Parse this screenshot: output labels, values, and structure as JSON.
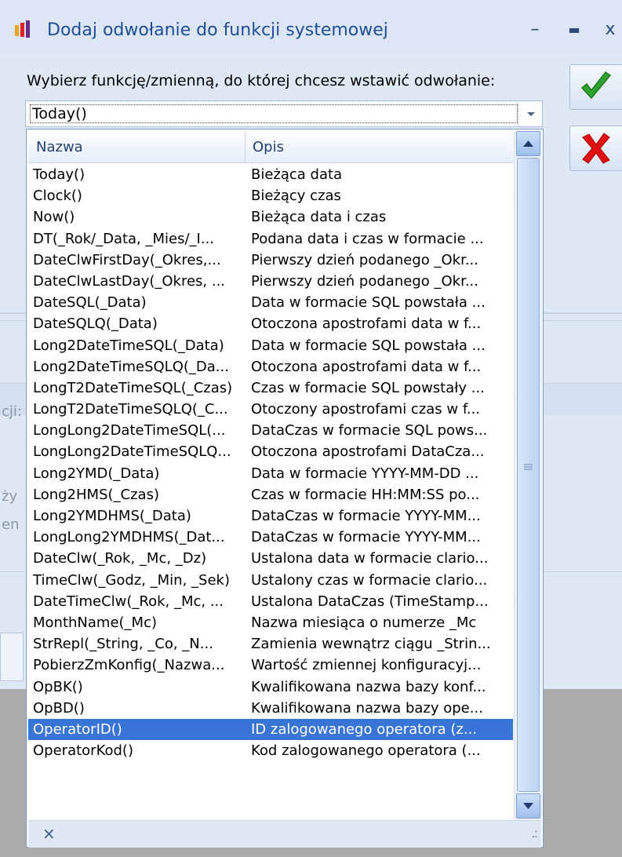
{
  "window": {
    "title": "Dodaj odwołanie do funkcji systemowej",
    "minimize_glyph": "–",
    "maximize_glyph": "▬",
    "close_glyph": "x"
  },
  "prompt": "Wybierz funkcję/zmienną, do której chcesz wstawić odwołanie:",
  "combo": {
    "value": "Today()"
  },
  "background_fragments": {
    "a": "cji:",
    "b": "ży",
    "c": "en"
  },
  "list": {
    "columns": [
      "Nazwa",
      "Opis"
    ],
    "rows": [
      {
        "name": "Today()",
        "desc": "Bieżąca data"
      },
      {
        "name": "Clock()",
        "desc": "Bieżący czas"
      },
      {
        "name": "Now()",
        "desc": "Bieżąca data i czas"
      },
      {
        "name": "DT(_Rok/_Data, _Mies/_I...",
        "desc": "Podana data i czas w formacie ..."
      },
      {
        "name": "DateClwFirstDay(_Okres,...",
        "desc": "Pierwszy dzień podanego _Okr..."
      },
      {
        "name": "DateClwLastDay(_Okres, ...",
        "desc": "Pierwszy dzień podanego _Okr..."
      },
      {
        "name": "DateSQL(_Data)",
        "desc": "Data w formacie SQL powstała ..."
      },
      {
        "name": "DateSQLQ(_Data)",
        "desc": "Otoczona apostrofami data w f..."
      },
      {
        "name": "Long2DateTimeSQL(_Data)",
        "desc": "Data w formacie SQL powstała ..."
      },
      {
        "name": "Long2DateTimeSQLQ(_Da...",
        "desc": "Otoczona apostrofami data w f..."
      },
      {
        "name": "LongT2DateTimeSQL(_Czas)",
        "desc": "Czas w formacie SQL powstały ..."
      },
      {
        "name": "LongT2DateTimeSQLQ(_C...",
        "desc": "Otoczony apostrofami czas w f..."
      },
      {
        "name": "LongLong2DateTimeSQL(...",
        "desc": "DataCzas w formacie SQL pows..."
      },
      {
        "name": "LongLong2DateTimeSQLQ...",
        "desc": "Otoczona apostrofami DataCza..."
      },
      {
        "name": "Long2YMD(_Data)",
        "desc": "Data w formacie YYYY-MM-DD ..."
      },
      {
        "name": "Long2HMS(_Czas)",
        "desc": "Czas w formacie HH:MM:SS po..."
      },
      {
        "name": "Long2YMDHMS(_Data)",
        "desc": "DataCzas w formacie YYYY-MM..."
      },
      {
        "name": "LongLong2YMDHMS(_Dat...",
        "desc": "DataCzas w formacie YYYY-MM..."
      },
      {
        "name": "DateClw(_Rok, _Mc, _Dz)",
        "desc": "Ustalona data w formacie clario..."
      },
      {
        "name": "TimeClw(_Godz, _Min, _Sek)",
        "desc": "Ustalony czas w formacie clario..."
      },
      {
        "name": "DateTimeClw(_Rok, _Mc, ...",
        "desc": "Ustalona DataCzas (TimeStamp..."
      },
      {
        "name": "MonthName(_Mc)",
        "desc": "Nazwa miesiąca o numerze _Mc"
      },
      {
        "name": "StrRepl(_String, _Co, _N...",
        "desc": "Zamienia wewnątrz ciągu _Strin..."
      },
      {
        "name": "PobierzZmKonfig(_Nazwa...",
        "desc": "Wartość zmiennej konfiguracyj..."
      },
      {
        "name": "OpBK()",
        "desc": "Kwalifikowana nazwa bazy konf..."
      },
      {
        "name": "OpBD()",
        "desc": "Kwalifikowana nazwa bazy ope..."
      },
      {
        "name": "OperatorID()",
        "desc": "ID zalogowanego operatora (z..."
      },
      {
        "name": "OperatorKod()",
        "desc": "Kod zalogowanego operatora (..."
      }
    ],
    "selected_index": 26
  },
  "footer": {
    "close_glyph": "×",
    "grip_glyph": ".:"
  },
  "colors": {
    "selection": "#3875d7",
    "accept_green": "#2fa12f",
    "cancel_red": "#e01010",
    "title_text": "#1f4e96"
  },
  "icons": {
    "app": "app-logo-icon",
    "accept": "checkmark-icon",
    "cancel": "red-x-icon",
    "scroll_up": "scroll-up-arrow-icon",
    "scroll_down": "scroll-down-arrow-icon",
    "grip": "thumb-grip-icon"
  }
}
